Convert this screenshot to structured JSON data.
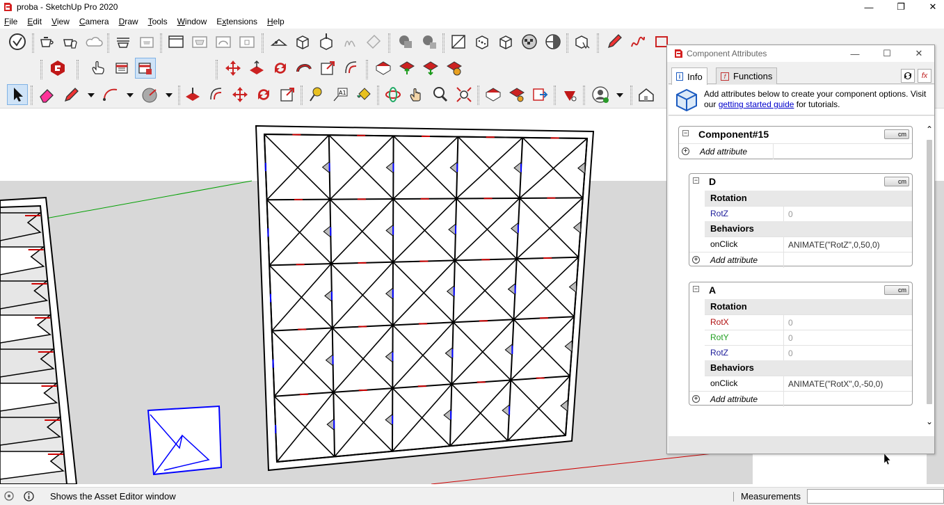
{
  "window": {
    "title": "proba - SketchUp Pro 2020"
  },
  "menu": [
    "File",
    "Edit",
    "View",
    "Camera",
    "Draw",
    "Tools",
    "Window",
    "Extensions",
    "Help"
  ],
  "menu_underline": [
    "F",
    "E",
    "V",
    "C",
    "D",
    "T",
    "W",
    "x",
    "H"
  ],
  "status": {
    "hint": "Shows the Asset Editor window",
    "measurements_label": "Measurements",
    "measurements_value": ""
  },
  "panel": {
    "title": "Component Attributes",
    "tabs": [
      "Info",
      "Functions"
    ],
    "info_text_before": "Add attributes below to create your component options. Visit our ",
    "info_link": "getting started guide",
    "info_text_after": " for tutorials.",
    "unit": "cm",
    "add_attribute": "Add attribute",
    "components": [
      {
        "name": "Component#15"
      },
      {
        "name": "D",
        "groups": [
          {
            "label": "Rotation",
            "rows": [
              {
                "key": "RotZ",
                "value": "0",
                "color": "#1a1a99"
              }
            ]
          },
          {
            "label": "Behaviors",
            "rows": [
              {
                "key": "onClick",
                "value": "ANIMATE(\"RotZ\",0,50,0)",
                "color": "#000000"
              }
            ]
          }
        ]
      },
      {
        "name": "A",
        "groups": [
          {
            "label": "Rotation",
            "rows": [
              {
                "key": "RotX",
                "value": "0",
                "color": "#b01010"
              },
              {
                "key": "RotY",
                "value": "0",
                "color": "#22a022"
              },
              {
                "key": "RotZ",
                "value": "0",
                "color": "#1a1a99"
              }
            ]
          },
          {
            "label": "Behaviors",
            "rows": [
              {
                "key": "onClick",
                "value": "ANIMATE(\"RotX\",0,-50,0)",
                "color": "#000000"
              }
            ]
          }
        ]
      }
    ]
  },
  "colors": {
    "sky": "#ffffff",
    "ground": "#d8d8d8",
    "selection": "#0000ff",
    "axis_red": "#cc0000",
    "axis_green": "#00a000",
    "axis_blue": "#0000ff"
  }
}
